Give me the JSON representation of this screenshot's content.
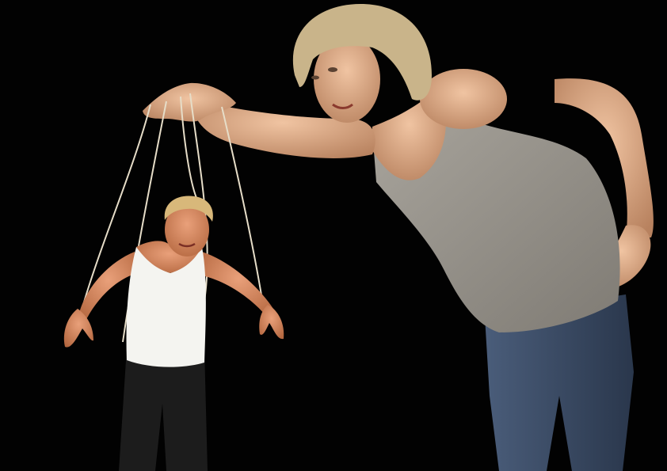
{
  "scene": {
    "background_color": "#020202",
    "puppeteer": {
      "hair_color": "#c9b48a",
      "skin_color": "#d9a582",
      "top_color": "#9a968e",
      "jeans_color": "#3b4c66"
    },
    "puppet": {
      "hair_color": "#d8b87a",
      "skin_color": "#d58a64",
      "undershirt_color": "#f4f4f0",
      "trousers_color": "#1c1c1c"
    },
    "string_color": "#e6ddc8"
  }
}
